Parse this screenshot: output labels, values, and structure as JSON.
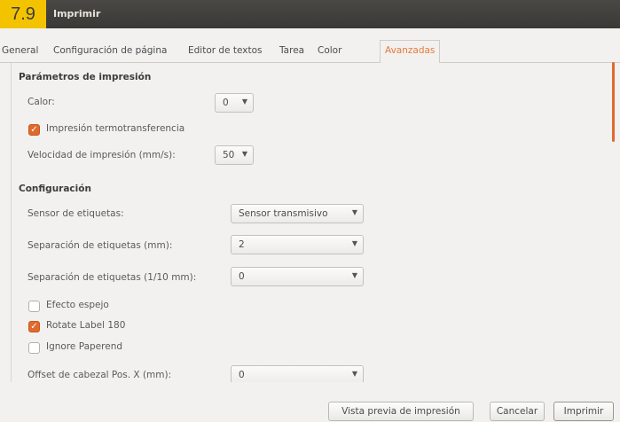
{
  "figure_number": "7.9",
  "window": {
    "title": "Imprimir"
  },
  "tabs": [
    {
      "label": "General"
    },
    {
      "label": "Configuración de página"
    },
    {
      "label": "Editor de textos"
    },
    {
      "label": "Tarea"
    },
    {
      "label": "Color"
    },
    {
      "label": "Avanzadas",
      "active": true
    }
  ],
  "print_params": {
    "heading": "Parámetros de impresión",
    "color_label": "Calor:",
    "color_value": "0",
    "thermal_label": "Impresión termotransferencia",
    "thermal_checked": true,
    "speed_label": "Velocidad de impresión (mm/s):",
    "speed_value": "50"
  },
  "config": {
    "heading": "Configuración",
    "sensor_label": "Sensor de etiquetas:",
    "sensor_value": "Sensor transmisivo",
    "gap_mm_label": "Separación de etiquetas (mm):",
    "gap_mm_value": "2",
    "gap_tenth_label": "Separación de etiquetas (1/10 mm):",
    "gap_tenth_value": "0",
    "mirror_label": "Efecto espejo",
    "mirror_checked": false,
    "rotate_label": "Rotate Label 180",
    "rotate_checked": true,
    "paperend_label": "Ignore Paperend",
    "paperend_checked": false,
    "offset_label": "Offset de cabezal Pos. X (mm):",
    "offset_value": "0"
  },
  "buttons": {
    "preview": "Vista previa de impresión",
    "cancel": "Cancelar",
    "print": "Imprimir"
  },
  "colors": {
    "accent": "#e06a2c",
    "titlebar": "#3f3d3a",
    "badge": "#f3c300"
  }
}
